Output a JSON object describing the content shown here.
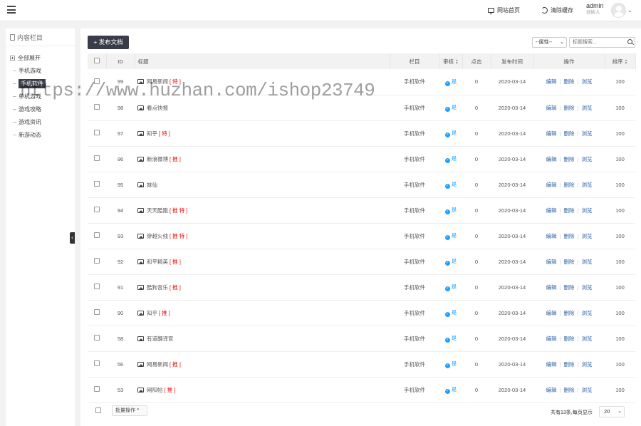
{
  "topbar": {
    "site_home": "网站首页",
    "clear_cache": "清除缓存",
    "user_name": "admin",
    "user_role": "创始人",
    "caret": "⌄"
  },
  "sidebar": {
    "header": "内容栏目",
    "items": [
      {
        "label": "全部展开"
      },
      {
        "label": "手机游戏"
      },
      {
        "label": "手机软件"
      },
      {
        "label": "单机游戏"
      },
      {
        "label": "游戏攻略"
      },
      {
        "label": "游戏资讯"
      },
      {
        "label": "新游动态"
      }
    ],
    "collapse_glyph": "‹"
  },
  "toolbar": {
    "publish_label": "+ 发布文档",
    "filter_value": "--属性--",
    "filter_caret": "⌄",
    "search_placeholder": "标题搜索..."
  },
  "table": {
    "headers": {
      "id": "ID",
      "title": "标题",
      "category": "栏目",
      "audit": "审核",
      "clicks": "点击",
      "date": "发布时间",
      "actions": "操作",
      "order": "排序"
    },
    "action_labels": {
      "edit": "编辑",
      "delete": "删除",
      "view": "浏览",
      "sep": "|"
    },
    "rows": [
      {
        "id": "99",
        "title": "网易新闻",
        "flag": "[ 特 ]",
        "category": "手机软件",
        "audit": "是",
        "clicks": "0",
        "date": "2020-03-14",
        "order": "100"
      },
      {
        "id": "98",
        "title": "看点快报",
        "flag": "",
        "category": "手机软件",
        "audit": "是",
        "clicks": "0",
        "date": "2020-03-14",
        "order": "100"
      },
      {
        "id": "97",
        "title": "知乎",
        "flag": "[ 特 ]",
        "category": "手机软件",
        "audit": "是",
        "clicks": "0",
        "date": "2020-03-14",
        "order": "100"
      },
      {
        "id": "96",
        "title": "新浪微博",
        "flag": "[ 推 ]",
        "category": "手机软件",
        "audit": "是",
        "clicks": "0",
        "date": "2020-03-14",
        "order": "100"
      },
      {
        "id": "95",
        "title": "妹仙",
        "flag": "",
        "category": "手机软件",
        "audit": "是",
        "clicks": "0",
        "date": "2020-03-14",
        "order": "100"
      },
      {
        "id": "94",
        "title": "天天酷跑",
        "flag": "[ 推 特 ]",
        "category": "手机软件",
        "audit": "是",
        "clicks": "0",
        "date": "2020-03-14",
        "order": "100"
      },
      {
        "id": "93",
        "title": "穿越火线",
        "flag": "[ 推 特 ]",
        "category": "手机软件",
        "audit": "是",
        "clicks": "0",
        "date": "2020-03-14",
        "order": "100"
      },
      {
        "id": "92",
        "title": "和平精英",
        "flag": "[ 推 ]",
        "category": "手机软件",
        "audit": "是",
        "clicks": "0",
        "date": "2020-03-14",
        "order": "100"
      },
      {
        "id": "91",
        "title": "酷狗音乐",
        "flag": "[ 推 ]",
        "category": "手机软件",
        "audit": "是",
        "clicks": "0",
        "date": "2020-03-14",
        "order": "100"
      },
      {
        "id": "90",
        "title": "知乎",
        "flag": "[ 推 ]",
        "category": "手机软件",
        "audit": "是",
        "clicks": "0",
        "date": "2020-03-14",
        "order": "100"
      },
      {
        "id": "58",
        "title": "有道翻译官",
        "flag": "",
        "category": "手机软件",
        "audit": "是",
        "clicks": "0",
        "date": "2020-03-14",
        "order": "100"
      },
      {
        "id": "56",
        "title": "网易新闻",
        "flag": "[ 推 ]",
        "category": "手机软件",
        "audit": "是",
        "clicks": "0",
        "date": "2020-03-14",
        "order": "100"
      },
      {
        "id": "53",
        "title": "网阳帖",
        "flag": "[ 推 ]",
        "category": "手机软件",
        "audit": "是",
        "clicks": "0",
        "date": "2020-03-14",
        "order": "100"
      }
    ]
  },
  "footer": {
    "batch_label": "批量操作 ^",
    "total_text": "共有13条,每页显示",
    "page_size": "20",
    "page_size_caret": "⌄"
  },
  "watermark": "https://www.huzhan.com/ishop23749",
  "colors": {
    "dark": "#393d49",
    "link": "#2d63a8",
    "accent": "#1e9fff",
    "flag": "#e00000"
  }
}
